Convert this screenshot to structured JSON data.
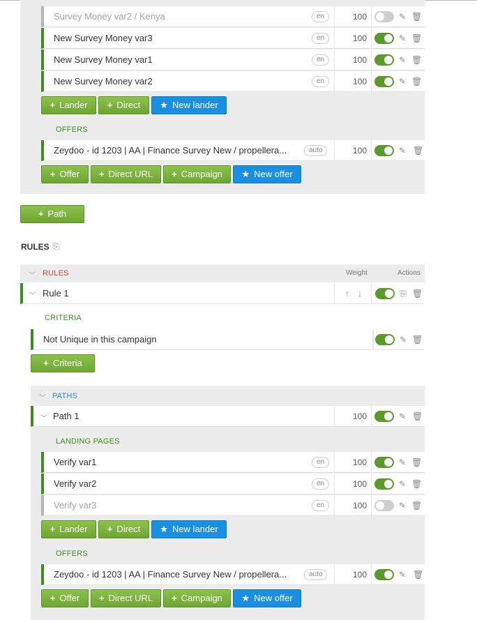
{
  "path0": {
    "landers": [
      {
        "name": "Survey Money var2 / Kenya",
        "lang": "en",
        "weight": "100",
        "active": false
      },
      {
        "name": "New Survey Money var3",
        "lang": "en",
        "weight": "100",
        "active": true
      },
      {
        "name": "New Survey Money var1",
        "lang": "en",
        "weight": "100",
        "active": true
      },
      {
        "name": "New Survey Money var2",
        "lang": "en",
        "weight": "100",
        "active": true
      }
    ],
    "lander_buttons": {
      "lander": "Lander",
      "direct": "Direct",
      "new_lander": "New lander"
    },
    "offers_label": "OFFERS",
    "offers": [
      {
        "name": "Zeydoo - id 1203 | AA | Finance Survey New / propellera...",
        "tag": "auto",
        "weight": "100",
        "active": true
      }
    ],
    "offer_buttons": {
      "offer": "Offer",
      "direct_url": "Direct URL",
      "campaign": "Campaign",
      "new_offer": "New offer"
    }
  },
  "add_path_label": "Path",
  "rules_title": "RULES",
  "rules_table": {
    "header": "RULES",
    "weight_header": "Weight",
    "actions_header": "Actions"
  },
  "rule1": {
    "name": "Rule 1"
  },
  "criteria": {
    "label": "CRITERIA",
    "items": [
      {
        "name": "Not Unique in this campaign",
        "active": true
      }
    ],
    "add_label": "Criteria"
  },
  "paths": {
    "label": "PATHS",
    "path1": {
      "name": "Path 1",
      "weight": "100",
      "active": true
    },
    "landing_label": "LANDING PAGES",
    "landers": [
      {
        "name": "Verify var1",
        "lang": "en",
        "weight": "100",
        "active": true
      },
      {
        "name": "Verify var2",
        "lang": "en",
        "weight": "100",
        "active": true
      },
      {
        "name": "Verify var3",
        "lang": "en",
        "weight": "100",
        "active": false
      }
    ],
    "lander_buttons": {
      "lander": "Lander",
      "direct": "Direct",
      "new_lander": "New lander"
    },
    "offers_label": "OFFERS",
    "offers": [
      {
        "name": "Zeydoo - id 1203 | AA | Finance Survey New / propellera...",
        "tag": "auto",
        "weight": "100",
        "active": true
      }
    ],
    "offer_buttons": {
      "offer": "Offer",
      "direct_url": "Direct URL",
      "campaign": "Campaign",
      "new_offer": "New offer"
    }
  },
  "icons": {
    "plus": "+",
    "star": "★",
    "edit": "pencil-icon",
    "delete": "trash-icon",
    "copy": "copy-icon"
  },
  "colors": {
    "green": "#5a9a2a",
    "blue": "#1a8fe0",
    "red": "#d2473d",
    "accent_bar": "#3a8f1e"
  }
}
